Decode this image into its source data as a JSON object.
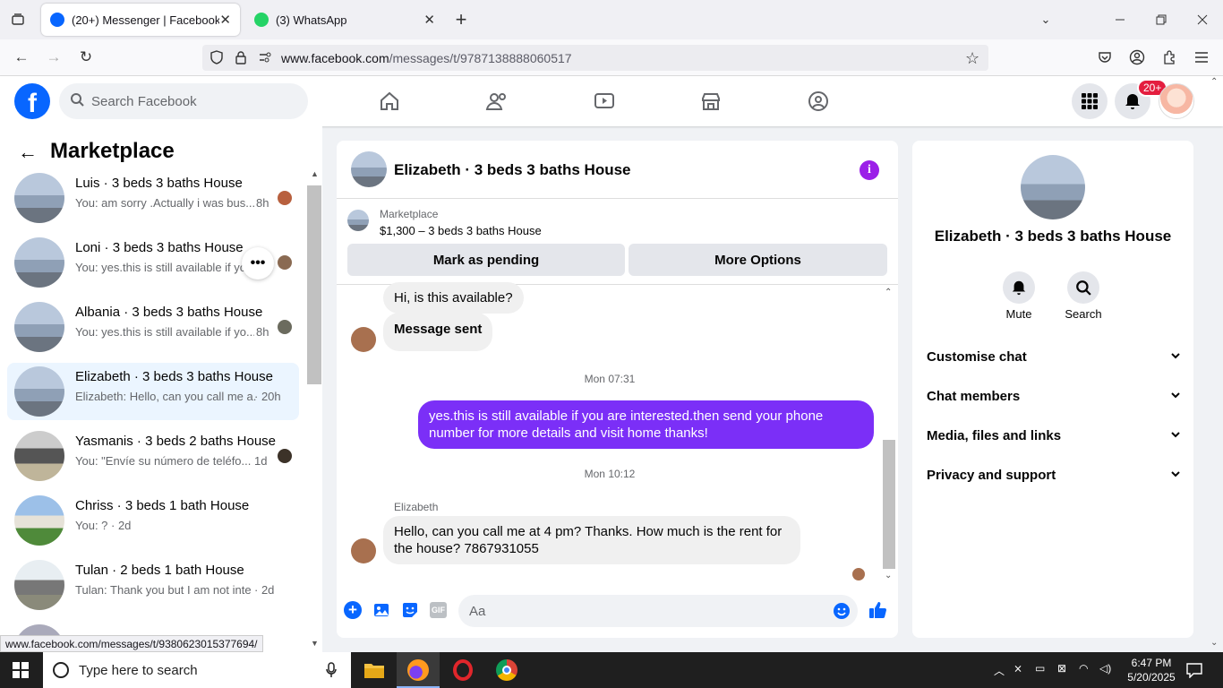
{
  "browser": {
    "tabs": [
      {
        "title": "(20+) Messenger | Facebook",
        "active": true
      },
      {
        "title": "(3) WhatsApp",
        "active": false
      }
    ],
    "url_domain": "www.facebook.com",
    "url_path": "/messages/t/9787138888060517",
    "status_url": "www.facebook.com/messages/t/9380623015377694/"
  },
  "header": {
    "logo": "f",
    "search_placeholder": "Search Facebook",
    "notif_badge": "20+"
  },
  "left": {
    "title": "Marketplace",
    "conversations": [
      {
        "name": "Luis · 3 beds 3 baths House",
        "snippet": "You: am sorry .Actually i was bus...",
        "time": "8h"
      },
      {
        "name": "Loni · 3 beds 3 baths House",
        "snippet": "You: yes.this is still available if yo...",
        "time": ""
      },
      {
        "name": "Albania · 3 beds 3 baths House",
        "snippet": "You: yes.this is still available if yo...",
        "time": "8h"
      },
      {
        "name": "Elizabeth · 3 beds 3 baths House",
        "snippet": "Elizabeth: Hello, can you call me a...",
        "time": "· 20h"
      },
      {
        "name": "Yasmanis · 3 beds 2 baths House",
        "snippet": "You: \"Envíe su número de teléfo...",
        "time": "1d"
      },
      {
        "name": "Chriss · 3 beds 1 bath House",
        "snippet": "You: ? · 2d",
        "time": ""
      },
      {
        "name": "Tulan · 2 beds 1 bath House",
        "snippet": "Tulan: Thank you but I am not inte...",
        "time": "· 2d"
      }
    ]
  },
  "chat": {
    "title": "Elizabeth · 3 beds 3 baths House",
    "listing_label": "Marketplace",
    "listing_detail": "$1,300 – 3 beds 3 baths House",
    "mark_pending": "Mark as pending",
    "more_options": "More Options",
    "msg1": "Hi, is this available?",
    "msg2": "Message sent",
    "ts1": "Mon 07:31",
    "msg3": "yes.this is still available if you are interested.then send your phone number for more details and visit home thanks!",
    "ts2": "Mon 10:12",
    "sender": "Elizabeth",
    "msg4": "Hello, can you call me at 4 pm? Thanks. How much is the rent for the house? 7867931055",
    "composer_placeholder": "Aa"
  },
  "right": {
    "name": "Elizabeth · 3 beds 3 baths House",
    "mute": "Mute",
    "search": "Search",
    "sections": [
      "Customise chat",
      "Chat members",
      "Media, files and links",
      "Privacy and support"
    ]
  },
  "taskbar": {
    "search_placeholder": "Type here to search",
    "time": "6:47 PM",
    "date": "5/20/2025"
  },
  "colors": {
    "brand": "#0866ff",
    "outgoing": "#7b2ff7",
    "badge": "#e41e3f"
  }
}
